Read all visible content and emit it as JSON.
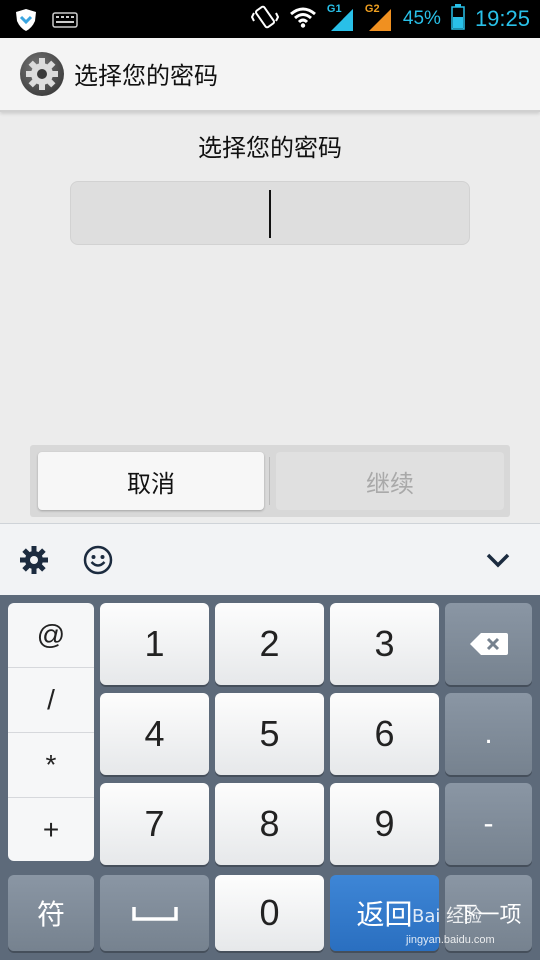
{
  "status_bar": {
    "battery_percent": "45%",
    "time": "19:25",
    "sim1_label": "G1",
    "sim2_label": "G2",
    "icons": [
      "shield-icon",
      "keyboard-icon",
      "vibrate-icon",
      "wifi-icon",
      "signal-icon",
      "signal-icon",
      "battery-icon"
    ]
  },
  "action_bar": {
    "title": "选择您的密码",
    "icon": "settings-gear-icon"
  },
  "main": {
    "prompt": "选择您的密码",
    "password_value": ""
  },
  "buttons": {
    "cancel": "取消",
    "continue": "继续"
  },
  "keyboard_toolbar": {
    "icons": [
      "gear-icon",
      "emoji-icon",
      "chevron-down-icon"
    ]
  },
  "keyboard": {
    "symbols": [
      "@",
      "/",
      "*",
      "+"
    ],
    "digits": [
      "1",
      "2",
      "3",
      "4",
      "5",
      "6",
      "7",
      "8",
      "9",
      "0"
    ],
    "dot": ".",
    "minus": "-",
    "sym_key": "符",
    "return_key": "返回",
    "next_key": "下一项",
    "colors": {
      "keyboard_bg": "#5d6a7a",
      "return_blue": "#2a6fc0",
      "accent": "#29c0e8"
    }
  },
  "watermark": {
    "brand": "Bai 经验",
    "url": "jingyan.baidu.com"
  }
}
